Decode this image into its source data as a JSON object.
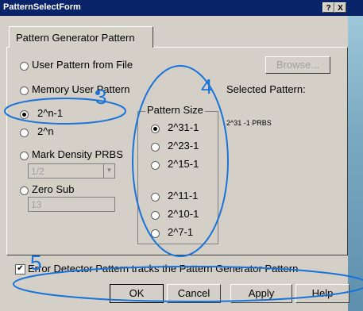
{
  "window": {
    "title": "PatternSelectForm",
    "help_button": "?",
    "close_button": "X"
  },
  "tab": {
    "label": "Pattern Generator Pattern"
  },
  "source_options": [
    {
      "label": "User Pattern from File",
      "selected": false
    },
    {
      "label": "Memory User Pattern",
      "selected": false
    },
    {
      "label": "2^n-1",
      "selected": true
    },
    {
      "label": "2^n",
      "selected": false
    },
    {
      "label": "Mark Density PRBS",
      "selected": false
    },
    {
      "label": "Zero Sub",
      "selected": false
    }
  ],
  "browse_button": "Browse...",
  "mark_density": {
    "value": "1/2"
  },
  "zero_sub": {
    "value": "13"
  },
  "selected_pattern": {
    "label": "Selected Pattern:",
    "value": "2^31 -1 PRBS"
  },
  "pattern_size": {
    "title": "Pattern Size",
    "options": [
      {
        "label": "2^31-1",
        "selected": true
      },
      {
        "label": "2^23-1",
        "selected": false
      },
      {
        "label": "2^15-1",
        "selected": false
      },
      {
        "label": "2^11-1",
        "selected": false
      },
      {
        "label": "2^10-1",
        "selected": false
      },
      {
        "label": "2^7-1",
        "selected": false
      }
    ]
  },
  "error_detector_checkbox": {
    "label": "Error Detector Pattern tracks the Pattern Generator Pattern",
    "checked": true
  },
  "buttons": {
    "ok": "OK",
    "cancel": "Cancel",
    "apply": "Apply",
    "help": "Help"
  },
  "callouts": {
    "c3": "3",
    "c4": "4",
    "c5": "5"
  },
  "colors": {
    "callout": "#1a73d9",
    "titlebar": "#0a246a",
    "face": "#d4d0c8"
  }
}
